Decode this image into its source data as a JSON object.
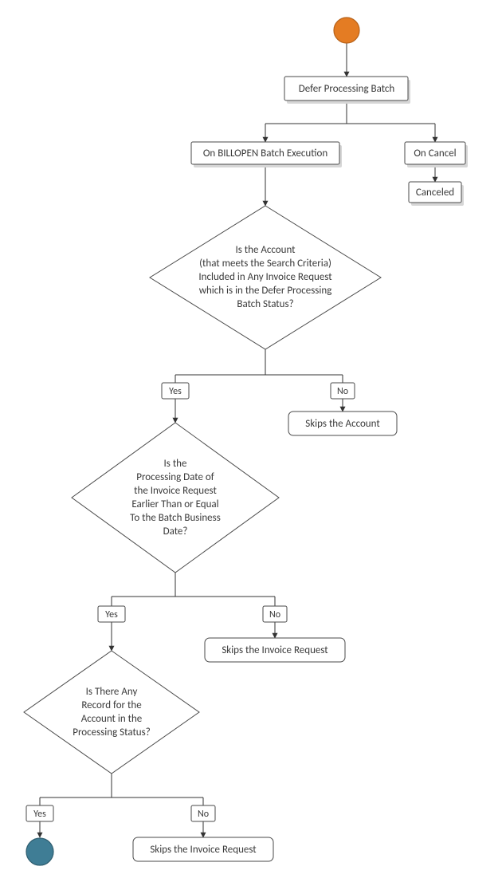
{
  "chart_data": {
    "type": "flowchart",
    "nodes": [
      {
        "id": "start",
        "kind": "start",
        "label": ""
      },
      {
        "id": "n1",
        "kind": "process",
        "label": "Defer Processing Batch"
      },
      {
        "id": "n2",
        "kind": "process",
        "label": "On BILLOPEN Batch Execution"
      },
      {
        "id": "n3",
        "kind": "process",
        "label": "On Cancel"
      },
      {
        "id": "n4",
        "kind": "terminal",
        "label": "Canceled"
      },
      {
        "id": "d1",
        "kind": "decision",
        "label": "Is the Account (that meets the Search Criteria) Included in Any Invoice Request which is in the Defer Processing Batch Status?"
      },
      {
        "id": "n5",
        "kind": "process",
        "label": "Skips the Account"
      },
      {
        "id": "d2",
        "kind": "decision",
        "label": "Is the Processing Date of the Invoice Request Earlier Than or Equal To the Batch Business Date?"
      },
      {
        "id": "n6",
        "kind": "process",
        "label": "Skips the Invoice Request"
      },
      {
        "id": "d3",
        "kind": "decision",
        "label": "Is There Any Record for the Account in the Processing Status?"
      },
      {
        "id": "n7",
        "kind": "process",
        "label": "Skips the Invoice Request"
      },
      {
        "id": "end",
        "kind": "end",
        "label": ""
      }
    ],
    "edges": [
      {
        "from": "start",
        "to": "n1",
        "label": ""
      },
      {
        "from": "n1",
        "to": "n2",
        "label": ""
      },
      {
        "from": "n1",
        "to": "n3",
        "label": ""
      },
      {
        "from": "n3",
        "to": "n4",
        "label": ""
      },
      {
        "from": "n2",
        "to": "d1",
        "label": ""
      },
      {
        "from": "d1",
        "to": "d2",
        "label": "Yes"
      },
      {
        "from": "d1",
        "to": "n5",
        "label": "No"
      },
      {
        "from": "d2",
        "to": "d3",
        "label": "Yes"
      },
      {
        "from": "d2",
        "to": "n6",
        "label": "No"
      },
      {
        "from": "d3",
        "to": "end",
        "label": "Yes"
      },
      {
        "from": "d3",
        "to": "n7",
        "label": "No"
      }
    ]
  },
  "labels": {
    "yes": "Yes",
    "no": "No"
  },
  "nodes": {
    "n1": "Defer Processing Batch",
    "n2": "On BILLOPEN Batch Execution",
    "n3": "On Cancel",
    "n4": "Canceled",
    "d1_l1": "Is the Account",
    "d1_l2": "(that meets the Search Criteria)",
    "d1_l3": "Included in Any Invoice Request",
    "d1_l4": "which is in the Defer Processing",
    "d1_l5": "Batch Status?",
    "n5": "Skips the Account",
    "d2_l1": "Is the",
    "d2_l2": "Processing Date of",
    "d2_l3": "the Invoice Request",
    "d2_l4": "Earlier Than or Equal",
    "d2_l5": "To the Batch Business",
    "d2_l6": "Date?",
    "n6": "Skips the Invoice Request",
    "d3_l1": "Is There Any",
    "d3_l2": "Record for the",
    "d3_l3": "Account in the",
    "d3_l4": "Processing Status?",
    "n7": "Skips the Invoice Request"
  }
}
